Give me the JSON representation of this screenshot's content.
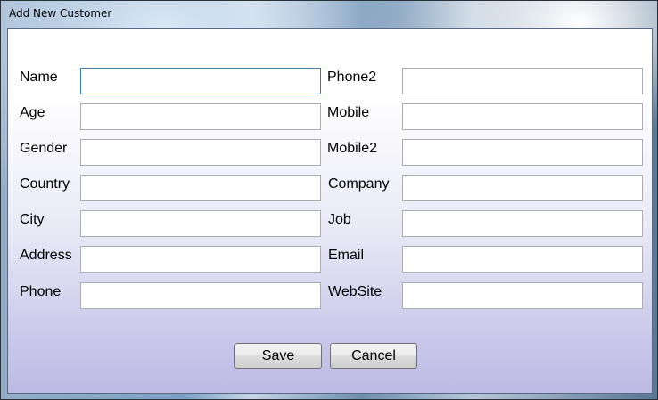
{
  "window": {
    "title": "Add New Customer"
  },
  "form": {
    "left": [
      {
        "label": "Name",
        "value": ""
      },
      {
        "label": "Age",
        "value": ""
      },
      {
        "label": "Gender",
        "value": ""
      },
      {
        "label": "Country",
        "value": ""
      },
      {
        "label": "City",
        "value": ""
      },
      {
        "label": "Address",
        "value": ""
      },
      {
        "label": "Phone",
        "value": ""
      }
    ],
    "right": [
      {
        "label": "Phone2",
        "value": ""
      },
      {
        "label": "Mobile",
        "value": ""
      },
      {
        "label": "Mobile2",
        "value": ""
      },
      {
        "label": "Company",
        "value": ""
      },
      {
        "label": "Job",
        "value": ""
      },
      {
        "label": "Email",
        "value": ""
      },
      {
        "label": "WebSite",
        "value": ""
      }
    ]
  },
  "buttons": {
    "save_label": "Save",
    "cancel_label": "Cancel"
  }
}
